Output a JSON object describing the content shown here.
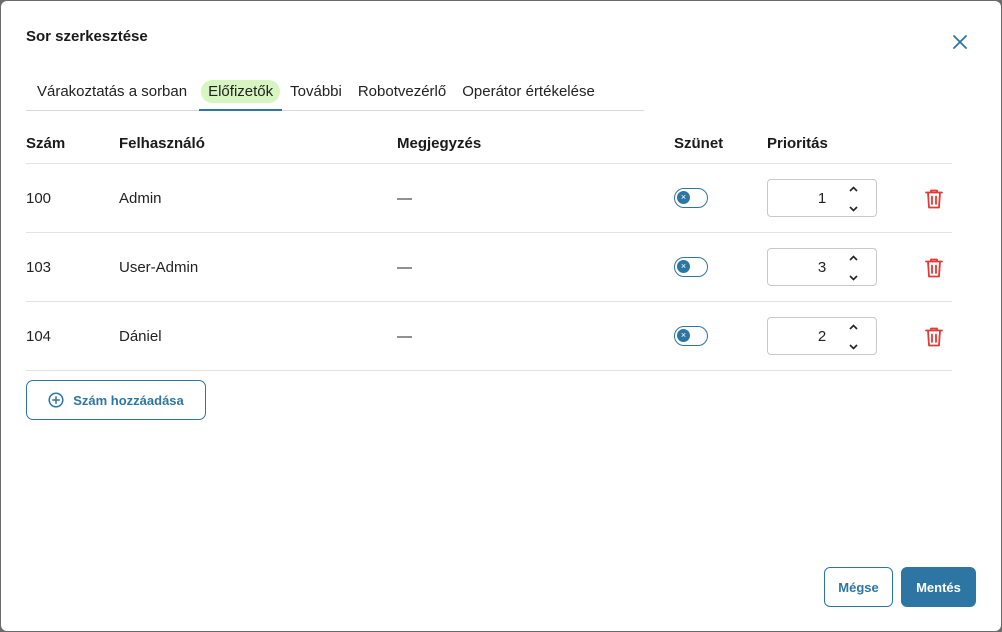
{
  "dialog": {
    "title": "Sor szerkesztése",
    "close_icon": "close-icon"
  },
  "tabs": [
    {
      "label": "Várakoztatás a sorban",
      "active": false
    },
    {
      "label": "Előfizetők",
      "active": true
    },
    {
      "label": "További",
      "active": false
    },
    {
      "label": "Robotvezérlő",
      "active": false
    },
    {
      "label": "Operátor értékelése",
      "active": false
    }
  ],
  "table": {
    "columns": [
      "Szám",
      "Felhasználó",
      "Megjegyzés",
      "Szünet",
      "Prioritás"
    ],
    "rows": [
      {
        "number": "100",
        "user": "Admin",
        "note": "—",
        "pause": false,
        "priority": "1"
      },
      {
        "number": "103",
        "user": "User-Admin",
        "note": "—",
        "pause": false,
        "priority": "3"
      },
      {
        "number": "104",
        "user": "Dániel",
        "note": "—",
        "pause": false,
        "priority": "2"
      }
    ]
  },
  "actions": {
    "add_label": "Szám hozzáadása",
    "cancel_label": "Mégse",
    "save_label": "Mentés"
  },
  "colors": {
    "accent": "#2d76a3",
    "active_tab_bg": "#d6f5c0",
    "danger": "#e53935"
  }
}
